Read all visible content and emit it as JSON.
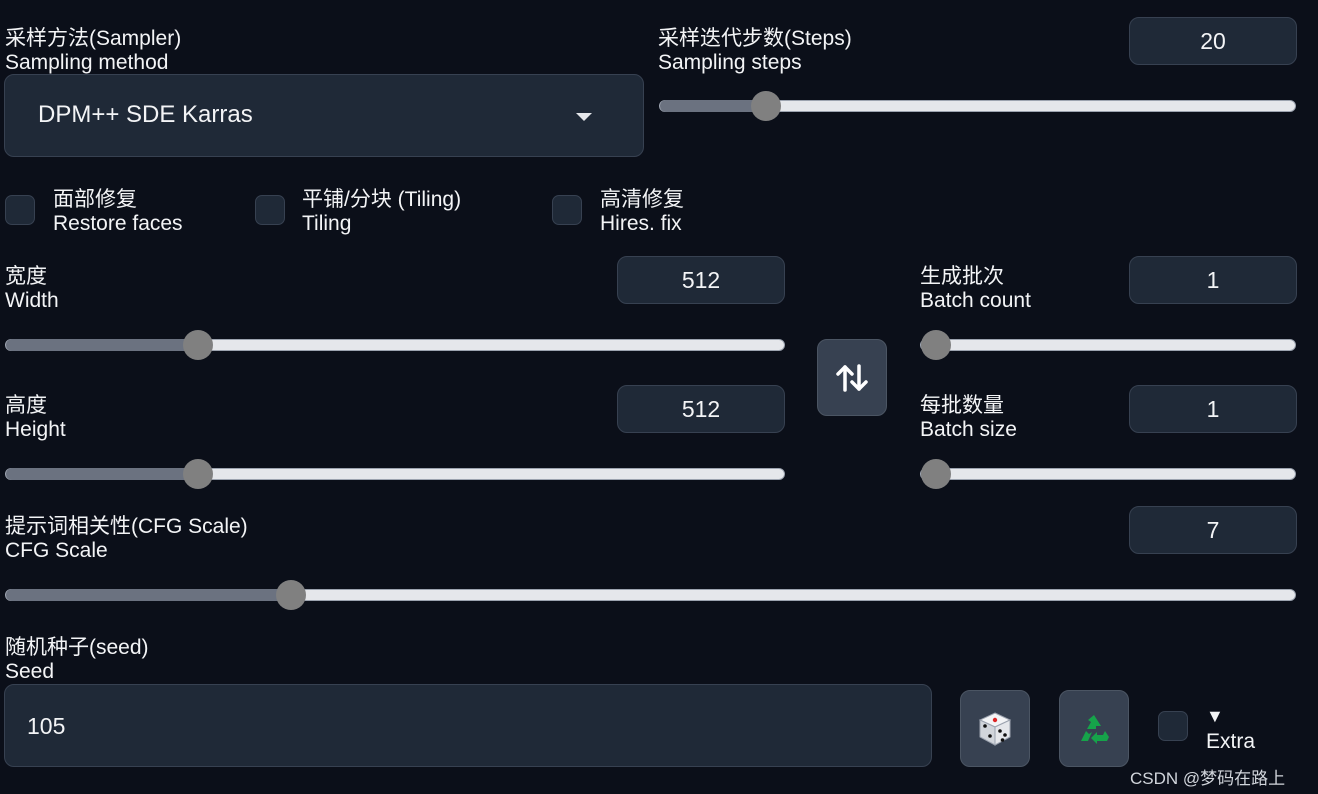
{
  "sampler": {
    "label_zh": "采样方法(Sampler)",
    "label_en": "Sampling method",
    "value": "DPM++ SDE Karras"
  },
  "steps": {
    "label_zh": "采样迭代步数(Steps)",
    "label_en": "Sampling steps",
    "value": "20",
    "fraction": 0.15
  },
  "checkboxes": {
    "restore_faces": {
      "label_zh": "面部修复",
      "label_en": "Restore faces"
    },
    "tiling": {
      "label_zh": "平铺/分块 (Tiling)",
      "label_en": "Tiling"
    },
    "hires": {
      "label_zh": "高清修复",
      "label_en": "Hires. fix"
    }
  },
  "width": {
    "label_zh": "宽度",
    "label_en": "Width",
    "value": "512",
    "fraction": 0.236
  },
  "height": {
    "label_zh": "高度",
    "label_en": "Height",
    "value": "512",
    "fraction": 0.236
  },
  "batch_count": {
    "label_zh": "生成批次",
    "label_en": "Batch count",
    "value": "1",
    "fraction": 0.0
  },
  "batch_size": {
    "label_zh": "每批数量",
    "label_en": "Batch size",
    "value": "1",
    "fraction": 0.0
  },
  "cfg": {
    "label_zh": "提示词相关性(CFG Scale)",
    "label_en": "CFG Scale",
    "value": "7",
    "fraction": 0.214
  },
  "seed": {
    "label_zh": "随机种子(seed)",
    "label_en": "Seed",
    "value": "105"
  },
  "extra": {
    "arrow": "▼",
    "label": "Extra"
  },
  "watermark": "CSDN @梦码在路上"
}
